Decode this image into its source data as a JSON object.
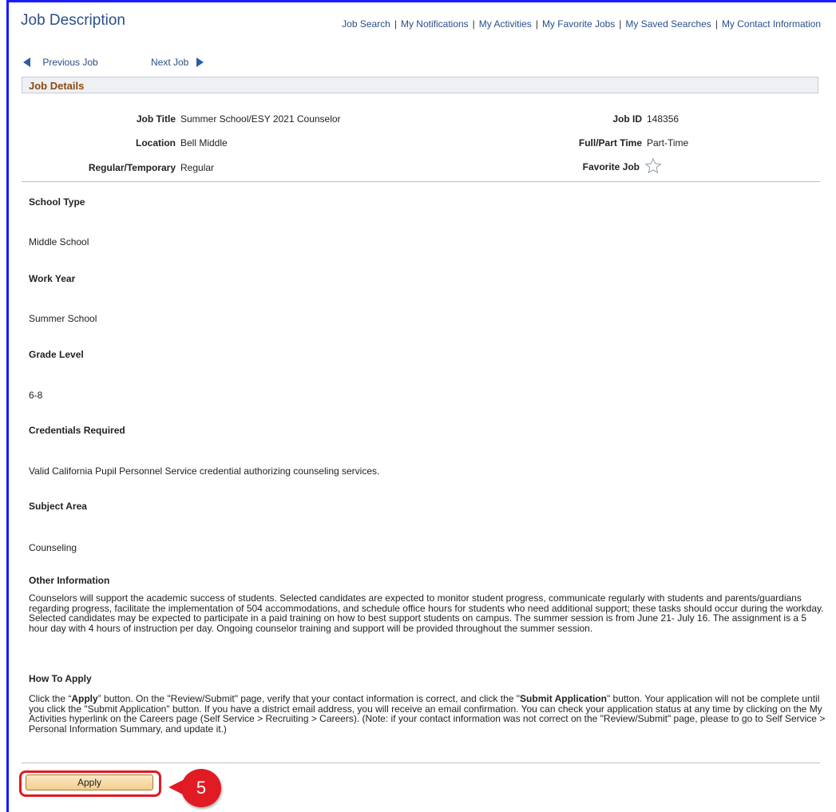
{
  "page_title": "Job Description",
  "topnav": [
    "Job Search",
    "My Notifications",
    "My Activities",
    "My Favorite Jobs",
    "My Saved Searches",
    "My Contact Information"
  ],
  "jobnav": {
    "previous": "Previous Job",
    "next": "Next Job"
  },
  "section_title": "Job Details",
  "details": {
    "job_title_label": "Job Title",
    "job_title": "Summer School/ESY 2021 Counselor",
    "location_label": "Location",
    "location": "Bell Middle",
    "regular_label": "Regular/Temporary",
    "regular": "Regular",
    "job_id_label": "Job ID",
    "job_id": "148356",
    "fulltime_label": "Full/Part Time",
    "fulltime": "Part-Time",
    "favorite_label": "Favorite Job"
  },
  "sections": {
    "school_type_heading": "School Type",
    "school_type": "Middle School",
    "work_year_heading": "Work Year",
    "work_year": "Summer School",
    "grade_heading": "Grade Level",
    "grade": "6-8",
    "credentials_heading": "Credentials Required",
    "credentials": "Valid California Pupil Personnel Service credential authorizing counseling services.",
    "subject_heading": "Subject Area",
    "subject": "Counseling",
    "other_heading": "Other Information",
    "other": "Counselors will support the academic success of students. Selected candidates are expected to monitor student progress, communicate regularly with students and parents/guardians regarding progress, facilitate the implementation of 504 accommodations, and schedule office hours for students who need additional support; these tasks should occur during the workday. Selected candidates may be expected to participate in a paid training on how to best support students on campus. The summer session is from June 21- July 16. The assignment is a 5 hour day with 4 hours of instruction per day. Ongoing counselor training and support will be provided throughout the summer session.",
    "how_heading": "How To Apply",
    "how_1": "Click the “",
    "how_apply": "Apply",
    "how_2": "” button. On the \"Review/Submit\" page, verify that your contact information is correct, and click the \"",
    "how_submit": "Submit Application",
    "how_3": "\" button. Your application will not be complete until you click the \"Submit Application\" button. If you have a district email address, you will receive an email confirmation. You can check your application status at any time by clicking on the My Activities hyperlink on the Careers page (Self Service > Recruiting > Careers). (Note: if your contact information was not correct on the \"Review/Submit\" page, please to go to Self Service > Personal Information Summary, and update it.)"
  },
  "apply_button": "Apply",
  "callout_number": "5",
  "colors": {
    "accent": "#e01b24",
    "link": "#2a4f88",
    "section_title": "#8a4a12"
  }
}
